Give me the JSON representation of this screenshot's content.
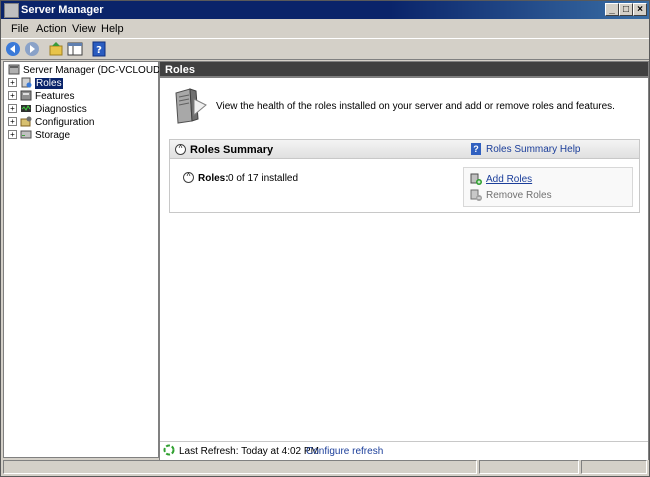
{
  "window": {
    "title": "Server Manager"
  },
  "menu": {
    "file": "File",
    "action": "Action",
    "view": "View",
    "help": "Help"
  },
  "tree": {
    "root": "Server Manager (DC-VCLOUD)",
    "items": [
      "Roles",
      "Features",
      "Diagnostics",
      "Configuration",
      "Storage"
    ]
  },
  "content": {
    "header": "Roles",
    "intro": "View the health of the roles installed on your server and add or remove roles and features.",
    "summary": {
      "title": "Roles Summary",
      "help_link": "Roles Summary Help",
      "roles_label": "Roles:",
      "roles_value": "0 of 17 installed",
      "add_roles": "Add Roles",
      "remove_roles": "Remove Roles"
    },
    "status": {
      "last_refresh": "Last Refresh: Today at 4:02 PM",
      "configure_refresh": "Configure refresh"
    }
  },
  "colors": {
    "accent": "#0a246a",
    "link": "#1b3e9a",
    "header_bg": "#404040"
  }
}
